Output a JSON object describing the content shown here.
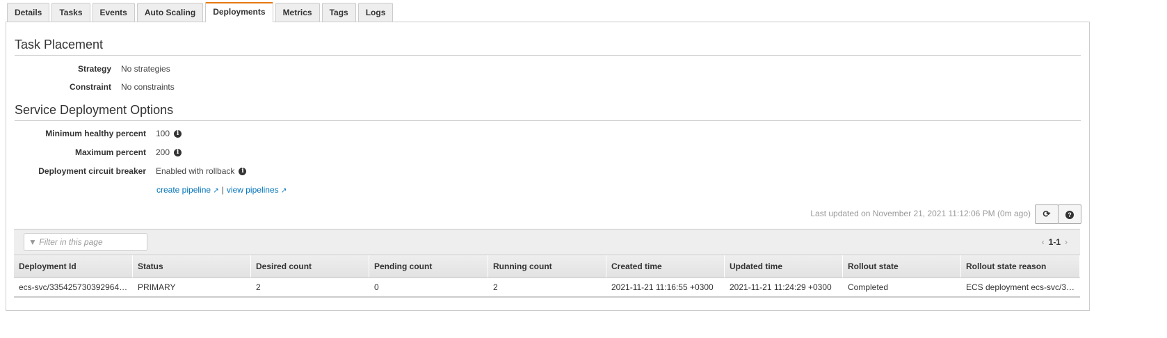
{
  "tabs": [
    "Details",
    "Tasks",
    "Events",
    "Auto Scaling",
    "Deployments",
    "Metrics",
    "Tags",
    "Logs"
  ],
  "active_tab": "Deployments",
  "task_placement": {
    "title": "Task Placement",
    "strategy_label": "Strategy",
    "strategy_value": "No strategies",
    "constraint_label": "Constraint",
    "constraint_value": "No constraints"
  },
  "deployment_options": {
    "title": "Service Deployment Options",
    "min_label": "Minimum healthy percent",
    "min_value": "100",
    "max_label": "Maximum percent",
    "max_value": "200",
    "cb_label": "Deployment circuit breaker",
    "cb_value": "Enabled with rollback",
    "create_link": "create pipeline",
    "separator": "|",
    "view_link": "view pipelines"
  },
  "last_updated": "Last updated on November 21, 2021 11:12:06 PM (0m ago)",
  "table": {
    "filter_placeholder": "Filter in this page",
    "pager": "1-1",
    "columns": [
      "Deployment Id",
      "Status",
      "Desired count",
      "Pending count",
      "Running count",
      "Created time",
      "Updated time",
      "Rollout state",
      "Rollout state reason"
    ],
    "rows": [
      [
        "ecs-svc/335425730392964…",
        "PRIMARY",
        "2",
        "0",
        "2",
        "2021-11-21 11:16:55 +0300",
        "2021-11-21 11:24:29 +0300",
        "Completed",
        "ECS deployment ecs-svc/3…"
      ]
    ]
  }
}
